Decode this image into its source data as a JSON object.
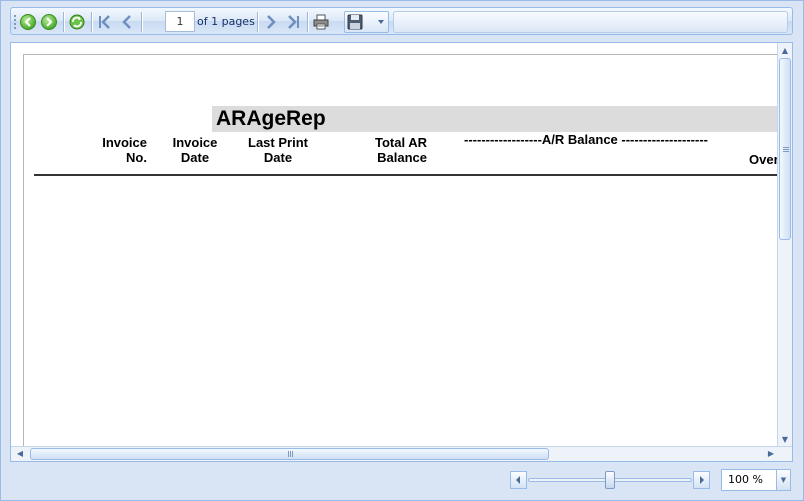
{
  "toolbar": {
    "current_page": "1",
    "of_pages": "of 1 pages",
    "icons": {
      "back": "back-icon",
      "forward": "forward-icon",
      "refresh": "refresh-icon",
      "first": "first-page-icon",
      "previous": "previous-page-icon",
      "next": "next-page-icon",
      "last": "last-page-icon",
      "print": "print-icon",
      "save": "save-icon"
    }
  },
  "report": {
    "title": "ARAgeRep",
    "columns": [
      {
        "line1": "Invoice",
        "line2": "No."
      },
      {
        "line1": "Invoice",
        "line2": "Date"
      },
      {
        "line1": "Last Print",
        "line2": "Date"
      },
      {
        "line1": "Total AR",
        "line2": "Balance"
      }
    ],
    "ar_balance_header": "------------------A/R Balance --------------------",
    "overflow_column": "Over"
  },
  "zoom": {
    "value": "100 %",
    "level_percent": 100
  },
  "colors": {
    "accent_border": "#99bbe8",
    "toolbar_bg": "#d9e6f7",
    "title_band": "#dcdcdc"
  }
}
